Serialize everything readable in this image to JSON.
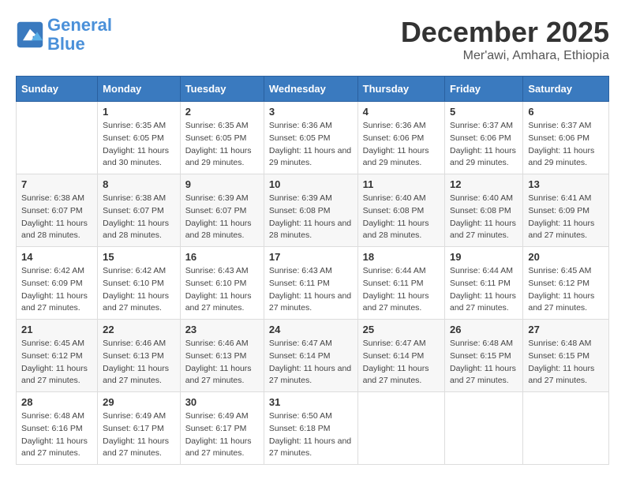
{
  "logo": {
    "line1": "General",
    "line2": "Blue"
  },
  "title": "December 2025",
  "subtitle": "Mer'awi, Amhara, Ethiopia",
  "header_days": [
    "Sunday",
    "Monday",
    "Tuesday",
    "Wednesday",
    "Thursday",
    "Friday",
    "Saturday"
  ],
  "weeks": [
    [
      {
        "day": "",
        "sunrise": "",
        "sunset": "",
        "daylight": ""
      },
      {
        "day": "1",
        "sunrise": "Sunrise: 6:35 AM",
        "sunset": "Sunset: 6:05 PM",
        "daylight": "Daylight: 11 hours and 30 minutes."
      },
      {
        "day": "2",
        "sunrise": "Sunrise: 6:35 AM",
        "sunset": "Sunset: 6:05 PM",
        "daylight": "Daylight: 11 hours and 29 minutes."
      },
      {
        "day": "3",
        "sunrise": "Sunrise: 6:36 AM",
        "sunset": "Sunset: 6:05 PM",
        "daylight": "Daylight: 11 hours and 29 minutes."
      },
      {
        "day": "4",
        "sunrise": "Sunrise: 6:36 AM",
        "sunset": "Sunset: 6:06 PM",
        "daylight": "Daylight: 11 hours and 29 minutes."
      },
      {
        "day": "5",
        "sunrise": "Sunrise: 6:37 AM",
        "sunset": "Sunset: 6:06 PM",
        "daylight": "Daylight: 11 hours and 29 minutes."
      },
      {
        "day": "6",
        "sunrise": "Sunrise: 6:37 AM",
        "sunset": "Sunset: 6:06 PM",
        "daylight": "Daylight: 11 hours and 29 minutes."
      }
    ],
    [
      {
        "day": "7",
        "sunrise": "Sunrise: 6:38 AM",
        "sunset": "Sunset: 6:07 PM",
        "daylight": "Daylight: 11 hours and 28 minutes."
      },
      {
        "day": "8",
        "sunrise": "Sunrise: 6:38 AM",
        "sunset": "Sunset: 6:07 PM",
        "daylight": "Daylight: 11 hours and 28 minutes."
      },
      {
        "day": "9",
        "sunrise": "Sunrise: 6:39 AM",
        "sunset": "Sunset: 6:07 PM",
        "daylight": "Daylight: 11 hours and 28 minutes."
      },
      {
        "day": "10",
        "sunrise": "Sunrise: 6:39 AM",
        "sunset": "Sunset: 6:08 PM",
        "daylight": "Daylight: 11 hours and 28 minutes."
      },
      {
        "day": "11",
        "sunrise": "Sunrise: 6:40 AM",
        "sunset": "Sunset: 6:08 PM",
        "daylight": "Daylight: 11 hours and 28 minutes."
      },
      {
        "day": "12",
        "sunrise": "Sunrise: 6:40 AM",
        "sunset": "Sunset: 6:08 PM",
        "daylight": "Daylight: 11 hours and 27 minutes."
      },
      {
        "day": "13",
        "sunrise": "Sunrise: 6:41 AM",
        "sunset": "Sunset: 6:09 PM",
        "daylight": "Daylight: 11 hours and 27 minutes."
      }
    ],
    [
      {
        "day": "14",
        "sunrise": "Sunrise: 6:42 AM",
        "sunset": "Sunset: 6:09 PM",
        "daylight": "Daylight: 11 hours and 27 minutes."
      },
      {
        "day": "15",
        "sunrise": "Sunrise: 6:42 AM",
        "sunset": "Sunset: 6:10 PM",
        "daylight": "Daylight: 11 hours and 27 minutes."
      },
      {
        "day": "16",
        "sunrise": "Sunrise: 6:43 AM",
        "sunset": "Sunset: 6:10 PM",
        "daylight": "Daylight: 11 hours and 27 minutes."
      },
      {
        "day": "17",
        "sunrise": "Sunrise: 6:43 AM",
        "sunset": "Sunset: 6:11 PM",
        "daylight": "Daylight: 11 hours and 27 minutes."
      },
      {
        "day": "18",
        "sunrise": "Sunrise: 6:44 AM",
        "sunset": "Sunset: 6:11 PM",
        "daylight": "Daylight: 11 hours and 27 minutes."
      },
      {
        "day": "19",
        "sunrise": "Sunrise: 6:44 AM",
        "sunset": "Sunset: 6:11 PM",
        "daylight": "Daylight: 11 hours and 27 minutes."
      },
      {
        "day": "20",
        "sunrise": "Sunrise: 6:45 AM",
        "sunset": "Sunset: 6:12 PM",
        "daylight": "Daylight: 11 hours and 27 minutes."
      }
    ],
    [
      {
        "day": "21",
        "sunrise": "Sunrise: 6:45 AM",
        "sunset": "Sunset: 6:12 PM",
        "daylight": "Daylight: 11 hours and 27 minutes."
      },
      {
        "day": "22",
        "sunrise": "Sunrise: 6:46 AM",
        "sunset": "Sunset: 6:13 PM",
        "daylight": "Daylight: 11 hours and 27 minutes."
      },
      {
        "day": "23",
        "sunrise": "Sunrise: 6:46 AM",
        "sunset": "Sunset: 6:13 PM",
        "daylight": "Daylight: 11 hours and 27 minutes."
      },
      {
        "day": "24",
        "sunrise": "Sunrise: 6:47 AM",
        "sunset": "Sunset: 6:14 PM",
        "daylight": "Daylight: 11 hours and 27 minutes."
      },
      {
        "day": "25",
        "sunrise": "Sunrise: 6:47 AM",
        "sunset": "Sunset: 6:14 PM",
        "daylight": "Daylight: 11 hours and 27 minutes."
      },
      {
        "day": "26",
        "sunrise": "Sunrise: 6:48 AM",
        "sunset": "Sunset: 6:15 PM",
        "daylight": "Daylight: 11 hours and 27 minutes."
      },
      {
        "day": "27",
        "sunrise": "Sunrise: 6:48 AM",
        "sunset": "Sunset: 6:15 PM",
        "daylight": "Daylight: 11 hours and 27 minutes."
      }
    ],
    [
      {
        "day": "28",
        "sunrise": "Sunrise: 6:48 AM",
        "sunset": "Sunset: 6:16 PM",
        "daylight": "Daylight: 11 hours and 27 minutes."
      },
      {
        "day": "29",
        "sunrise": "Sunrise: 6:49 AM",
        "sunset": "Sunset: 6:17 PM",
        "daylight": "Daylight: 11 hours and 27 minutes."
      },
      {
        "day": "30",
        "sunrise": "Sunrise: 6:49 AM",
        "sunset": "Sunset: 6:17 PM",
        "daylight": "Daylight: 11 hours and 27 minutes."
      },
      {
        "day": "31",
        "sunrise": "Sunrise: 6:50 AM",
        "sunset": "Sunset: 6:18 PM",
        "daylight": "Daylight: 11 hours and 27 minutes."
      },
      {
        "day": "",
        "sunrise": "",
        "sunset": "",
        "daylight": ""
      },
      {
        "day": "",
        "sunrise": "",
        "sunset": "",
        "daylight": ""
      },
      {
        "day": "",
        "sunrise": "",
        "sunset": "",
        "daylight": ""
      }
    ]
  ]
}
